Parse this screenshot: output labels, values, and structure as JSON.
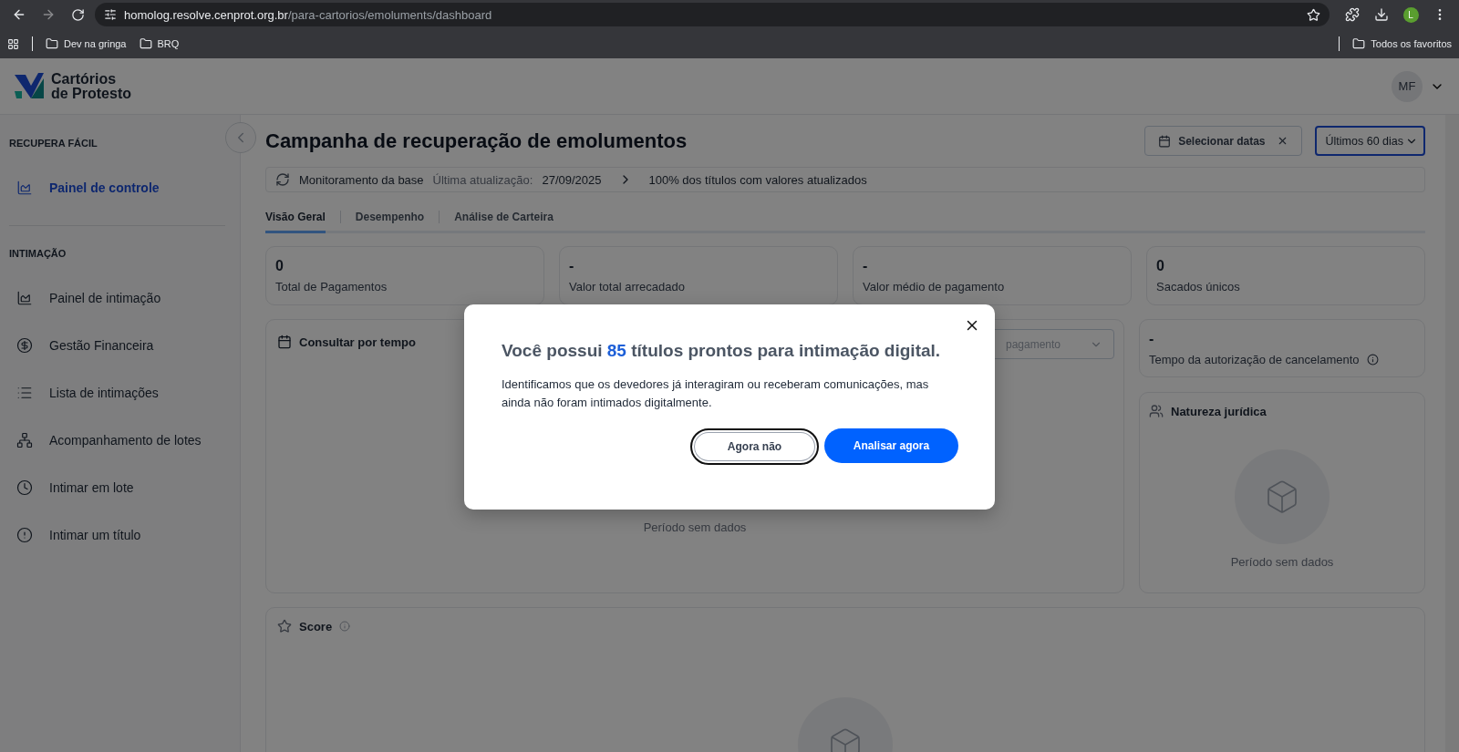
{
  "browser": {
    "url_host": "homolog.resolve.cenprot.org.br",
    "url_path": "/para-cartorios/emoluments/dashboard",
    "bookmarks": [
      "Dev na gringa",
      "BRQ"
    ],
    "all_bookmarks": "Todos os favoritos",
    "profile": "L"
  },
  "header": {
    "logo_line1": "Cartórios",
    "logo_line2": "de Protesto",
    "avatar": "MF"
  },
  "sidebar": {
    "sections": [
      {
        "title": "RECUPERA FÁCIL",
        "items": [
          {
            "label": "Painel de controle",
            "kind": "chart",
            "selected": true
          }
        ]
      },
      {
        "title": "INTIMAÇÃO",
        "items": [
          {
            "label": "Painel de intimação",
            "kind": "chart",
            "selected": false
          },
          {
            "label": "Gestão Financeira",
            "kind": "dollar",
            "selected": false
          },
          {
            "label": "Lista de intimações",
            "kind": "list",
            "selected": false
          },
          {
            "label": "Acompanhamento de lotes",
            "kind": "hierarchy",
            "selected": false
          },
          {
            "label": "Intimar em lote",
            "kind": "clock",
            "selected": false
          },
          {
            "label": "Intimar um título",
            "kind": "alert",
            "selected": false
          }
        ]
      }
    ]
  },
  "page": {
    "title": "Campanha de recuperação de emolumentos",
    "date_button": "Selecionar datas",
    "period_select": "Últimos 60 dias",
    "monitor": {
      "label": "Monitoramento da base",
      "update_label": "Última atualização:",
      "update_date": "27/09/2025",
      "summary": "100% dos títulos com valores atualizados"
    },
    "tabs": [
      {
        "label": "Visão Geral",
        "selected": true
      },
      {
        "label": "Desempenho",
        "selected": false
      },
      {
        "label": "Análise de Carteira",
        "selected": false
      }
    ],
    "stats": [
      {
        "value": "0",
        "label": "Total de Pagamentos"
      },
      {
        "value": "-",
        "label": "Valor total arrecadado"
      },
      {
        "value": "-",
        "label": "Valor médio de pagamento"
      },
      {
        "value": "0",
        "label": "Sacados únicos"
      }
    ],
    "time_card": {
      "title": "Consultar por tempo",
      "select_value": "pagamento",
      "empty": "Período sem dados"
    },
    "cancel_card": {
      "value": "-",
      "label": "Tempo da autorização de cancelamento"
    },
    "nature_card": {
      "title": "Natureza jurídica",
      "empty": "Período sem dados"
    },
    "score_card": {
      "title": "Score"
    }
  },
  "modal": {
    "heading_before": "Você possui",
    "count": "85",
    "heading_after": "títulos prontos para intimação digital.",
    "body": "Identificamos que os devedores já interagiram ou receberam comunicações, mas ainda não foram intimados digitalmente.",
    "secondary_button": "Agora não",
    "primary_button": "Analisar agora"
  }
}
